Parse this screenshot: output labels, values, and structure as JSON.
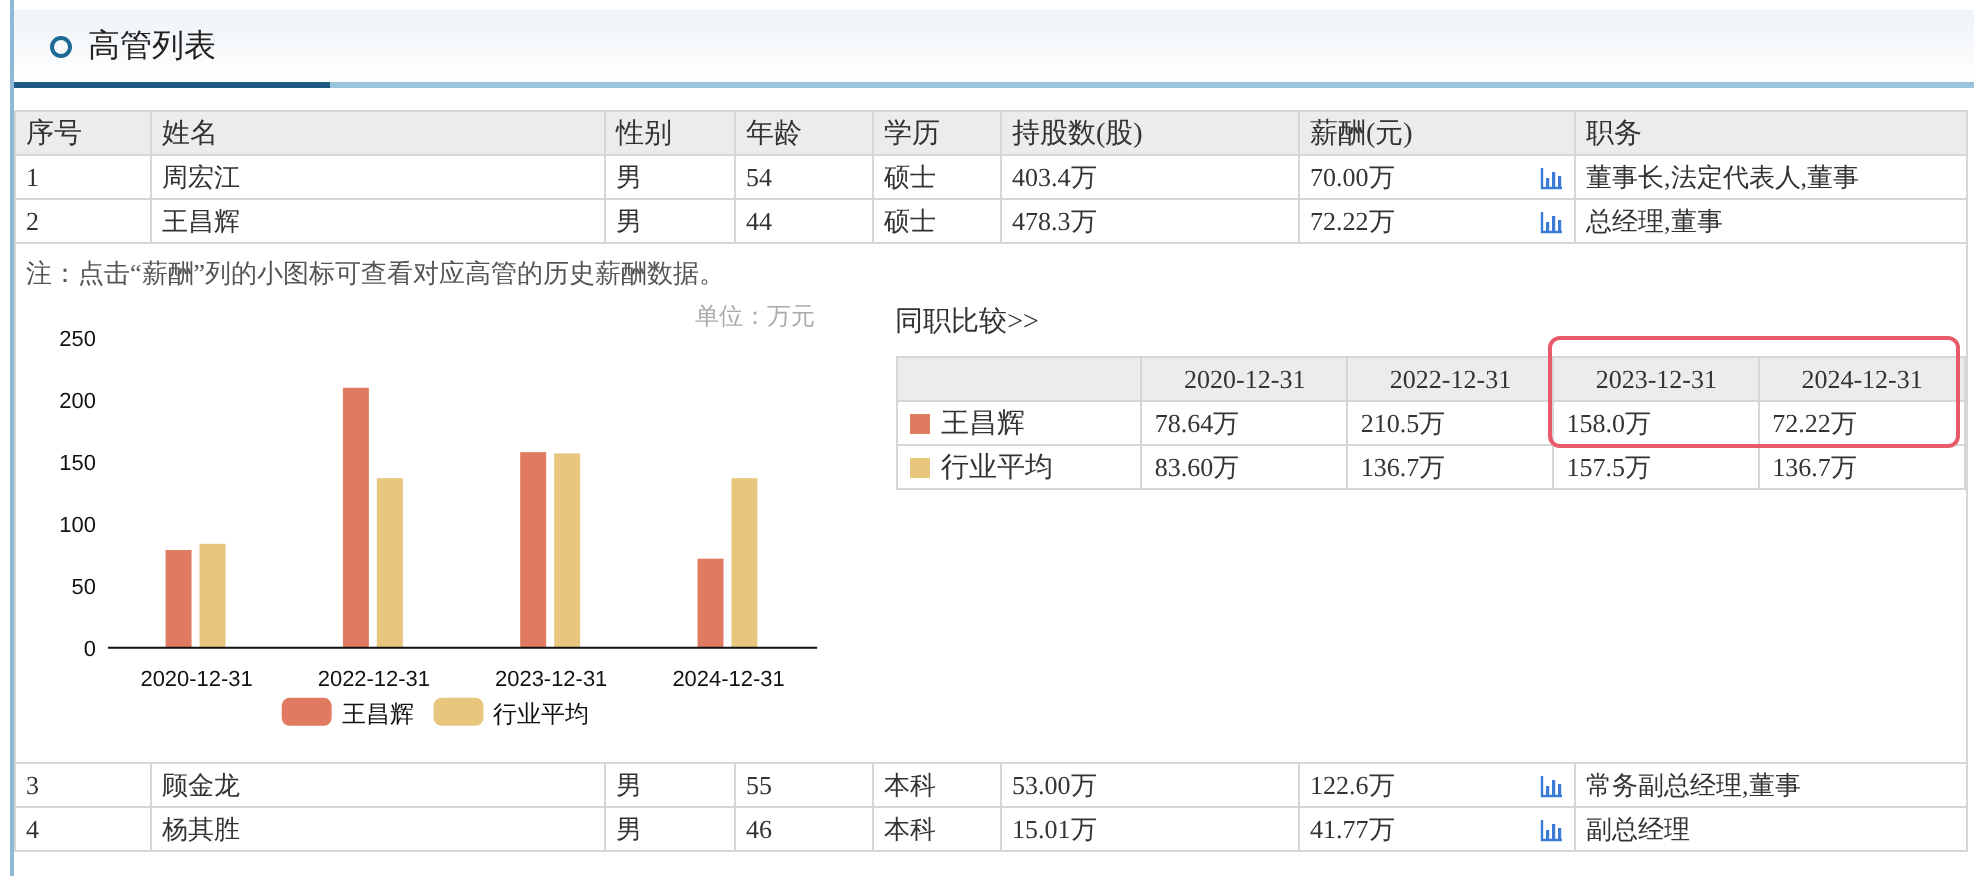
{
  "section": {
    "title": "高管列表"
  },
  "table": {
    "columns": [
      "序号",
      "姓名",
      "性别",
      "年龄",
      "学历",
      "持股数(股)",
      "薪酬(元)",
      "职务"
    ],
    "rows": [
      {
        "kind": "person",
        "cells": [
          "1",
          "周宏江",
          "男",
          "54",
          "硕士",
          "403.4万",
          "70.00万",
          "董事长,法定代表人,董事"
        ]
      },
      {
        "kind": "person",
        "cells": [
          "2",
          "王昌辉",
          "男",
          "44",
          "硕士",
          "478.3万",
          "72.22万",
          "总经理,董事"
        ]
      },
      {
        "kind": "detail",
        "note": "注：点击“薪酬”列的小图标可查看对应高管的历史薪酬数据。",
        "unit": "单位：万元",
        "chart_data": {
          "type": "bar",
          "categories": [
            "2020-12-31",
            "2022-12-31",
            "2023-12-31",
            "2024-12-31"
          ],
          "series": [
            {
              "name": "王昌辉",
              "color": "#e07a60",
              "values": [
                79,
                210,
                158,
                72
              ]
            },
            {
              "name": "行业平均",
              "color": "#e8c67e",
              "values": [
                84,
                137,
                157,
                137
              ]
            }
          ],
          "legend": true,
          "ylim": [
            0,
            250
          ],
          "yticks": [
            0,
            50,
            100,
            150,
            200,
            250
          ]
        },
        "comparison": {
          "title": "同职比较>>",
          "columns": [
            {
              "label": "2020-12-31"
            },
            {
              "label": "2022-12-31"
            },
            {
              "label": "2023-12-31",
              "highlighted": true
            },
            {
              "label": "2024-12-31",
              "highlighted": true
            }
          ],
          "rows": [
            {
              "name": "王昌辉",
              "color": "#e07a60",
              "values": [
                "78.64万",
                "210.5万",
                "158.0万",
                "72.22万"
              ]
            },
            {
              "name": "行业平均",
              "color": "#e8c67e",
              "values": [
                "83.60万",
                "136.7万",
                "157.5万",
                "136.7万"
              ]
            }
          ]
        }
      },
      {
        "kind": "person",
        "cells": [
          "3",
          "顾金龙",
          "男",
          "55",
          "本科",
          "53.00万",
          "122.6万",
          "常务副总经理,董事"
        ]
      },
      {
        "kind": "person",
        "cells": [
          "4",
          "杨其胜",
          "男",
          "46",
          "本科",
          "15.01万",
          "41.77万",
          "副总经理"
        ]
      }
    ]
  }
}
